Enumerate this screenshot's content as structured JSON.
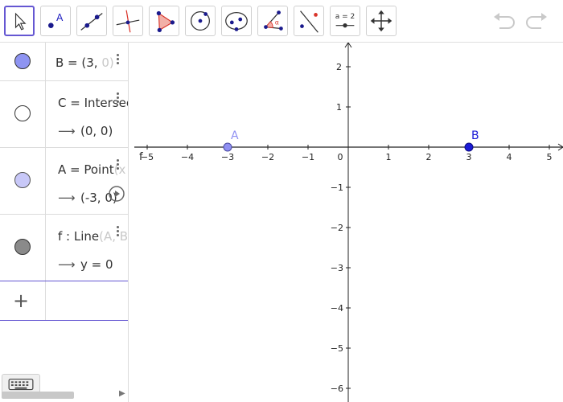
{
  "toolbar": {
    "tools": [
      {
        "id": "move",
        "icon": "cursor-arrow-icon",
        "selected": true
      },
      {
        "id": "point",
        "icon": "point-icon",
        "label": "A"
      },
      {
        "id": "line",
        "icon": "line-through-two-points-icon"
      },
      {
        "id": "perpendicular",
        "icon": "perpendicular-line-icon"
      },
      {
        "id": "polygon",
        "icon": "polygon-icon"
      },
      {
        "id": "circle",
        "icon": "circle-center-point-icon"
      },
      {
        "id": "ellipse",
        "icon": "ellipse-icon"
      },
      {
        "id": "angle",
        "icon": "angle-icon",
        "label": "α"
      },
      {
        "id": "reflect",
        "icon": "reflect-about-line-icon"
      },
      {
        "id": "slider",
        "icon": "slider-icon",
        "label": "a = 2"
      },
      {
        "id": "move-graphics",
        "icon": "move-graphics-view-icon"
      }
    ],
    "undo_icon": "undo-icon",
    "redo_icon": "redo-icon"
  },
  "algebra": {
    "rows": [
      {
        "name": "B",
        "definition": "B = (3, 0)",
        "def_main": "B = (3, ",
        "def_fade": "0)",
        "output": "",
        "marble_color": "#9aa0f5",
        "marble_filled": true
      },
      {
        "name": "C",
        "definition": "C = Intersect",
        "def_main": "C = Intersec",
        "def_fade": "",
        "output": "(0, 0)",
        "marble_color": "#ffffff",
        "marble_filled": false
      },
      {
        "name": "A",
        "definition": "A = Point(x",
        "def_main": "A = Point",
        "def_fade": "(x",
        "output": "(-3, 0)",
        "marble_color": "#c8c8f8",
        "marble_filled": true
      },
      {
        "name": "f",
        "definition": "f : Line(A, B",
        "def_main": "f : Line",
        "def_fade": "(A, B",
        "output": "y = 0",
        "marble_color": "#888888",
        "marble_filled": true
      }
    ],
    "add_label": "+",
    "output_arrow": "⟶"
  },
  "graph": {
    "x_ticks": [
      "−5",
      "−4",
      "−3",
      "−2",
      "−1",
      "0",
      "1",
      "2",
      "3",
      "4",
      "5"
    ],
    "y_ticks_pos": [
      "2",
      "1"
    ],
    "y_ticks_neg": [
      "−1",
      "−2",
      "−3",
      "−4",
      "−5",
      "−6"
    ],
    "origin_label": "0",
    "point_a": {
      "label": "A",
      "x": -3,
      "y": 0,
      "color": "#8f8ff2"
    },
    "point_b": {
      "label": "B",
      "x": 3,
      "y": 0,
      "color": "#1a1ad6"
    },
    "line_label": "f"
  }
}
